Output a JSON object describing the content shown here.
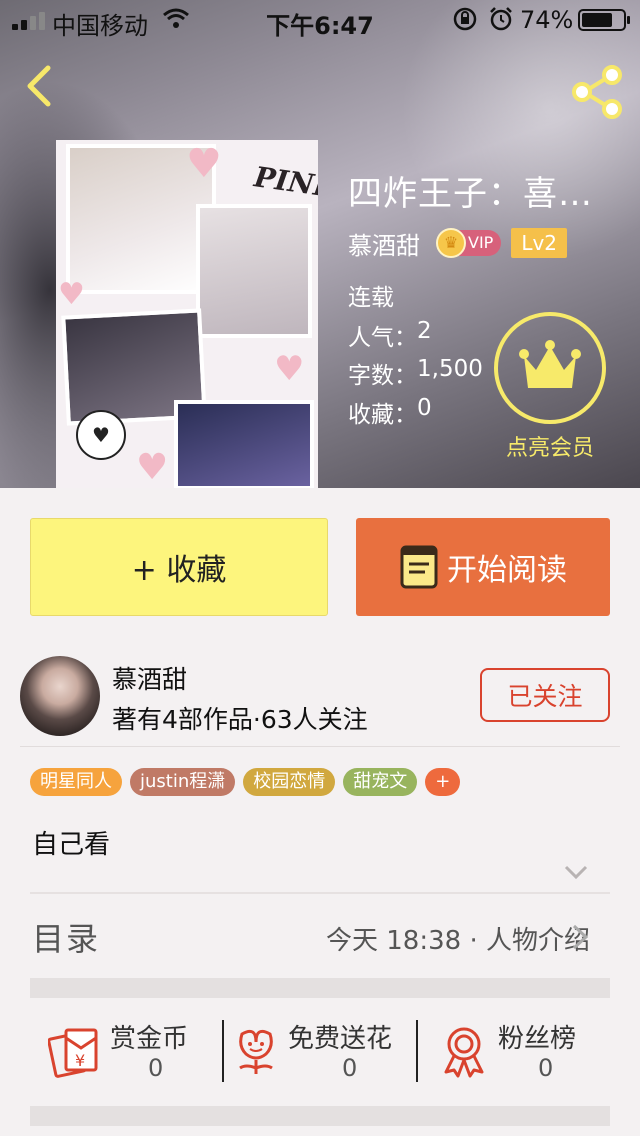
{
  "status_bar": {
    "carrier": "中国移动",
    "time": "下午6:47",
    "battery": "74%",
    "battery_level": 0.74
  },
  "book": {
    "title": "四炸王子：喜…",
    "author": "慕酒甜",
    "vip": "VIP",
    "level": "Lv2",
    "status": "连载",
    "popularity_label": "人气：",
    "popularity": "2",
    "words_label": "字数：",
    "words": "1,500",
    "favorites_label": "收藏：",
    "favorites": "0",
    "cover_word": "PINK",
    "member_label": "点亮会员"
  },
  "actions": {
    "favorite": "+ 收藏",
    "read": "开始阅读"
  },
  "author_card": {
    "name": "慕酒甜",
    "stats": "著有4部作品·63人关注",
    "follow": "已关注"
  },
  "tags": [
    {
      "label": "明星同人",
      "color": "#f6a33d"
    },
    {
      "label": "justin程潇",
      "color": "#c07a66"
    },
    {
      "label": "校园恋情",
      "color": "#d1a83f"
    },
    {
      "label": "甜宠文",
      "color": "#98b45e"
    },
    {
      "label": "+",
      "color": "#ee6a3d"
    }
  ],
  "intro": "自己看",
  "toc": {
    "label": "目录",
    "latest": "今天 18:38 · 人物介绍"
  },
  "stats": [
    {
      "label": "赏金币",
      "value": "0",
      "icon": "red-envelope-icon"
    },
    {
      "label": "免费送花",
      "value": "0",
      "icon": "flower-icon"
    },
    {
      "label": "粉丝榜",
      "value": "0",
      "icon": "medal-icon"
    }
  ],
  "colors": {
    "favorite_bg": "#fdf57d",
    "read_bg": "#e8703f",
    "follow_red": "#d9432e",
    "member_yellow": "#f7ea6a",
    "back_yellow": "#f7e86a"
  }
}
